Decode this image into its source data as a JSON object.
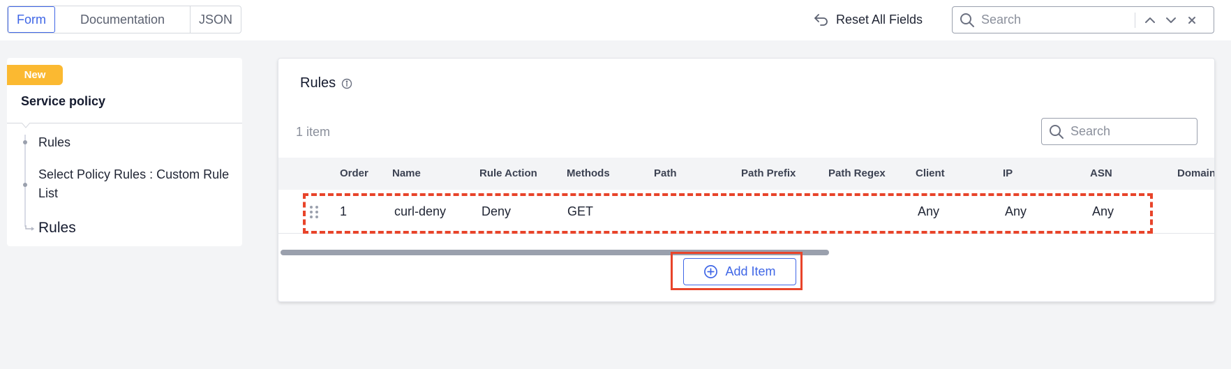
{
  "colors": {
    "accent": "#3f66e6",
    "badge": "#fbb931",
    "highlight": "#e8442a",
    "background": "#f3f4f6"
  },
  "header": {
    "tabs": [
      "Form",
      "Documentation",
      "JSON"
    ],
    "active_tab": "Form",
    "reset_label": "Reset All Fields",
    "reset_icon": "undo-arrow-icon",
    "search_placeholder": "Search",
    "search_icons": [
      "search-icon",
      "chevron-up-icon",
      "chevron-down-icon",
      "close-icon"
    ]
  },
  "sidebar": {
    "badge": "New",
    "title": "Service policy",
    "items": [
      {
        "label": "Rules"
      },
      {
        "label": "Select Policy Rules : Custom Rule List"
      },
      {
        "label": "Rules",
        "current": true
      }
    ]
  },
  "rules": {
    "title": "Rules",
    "title_icon": "info-icon",
    "item_count": "1 item",
    "search_placeholder": "Search",
    "columns": [
      "Order",
      "Name",
      "Rule Action",
      "Methods",
      "Path",
      "Path Prefix",
      "Path Regex",
      "Client",
      "IP",
      "ASN",
      "Domain"
    ],
    "rows": [
      {
        "order": "1",
        "name": "curl-deny",
        "rule_action": "Deny",
        "methods": "GET",
        "path": "",
        "path_prefix": "",
        "path_regex": "",
        "client": "Any",
        "ip": "Any",
        "asn": "Any",
        "domain": ""
      }
    ],
    "add_item_label": "Add Item",
    "add_item_icon": "plus-circle-icon"
  }
}
